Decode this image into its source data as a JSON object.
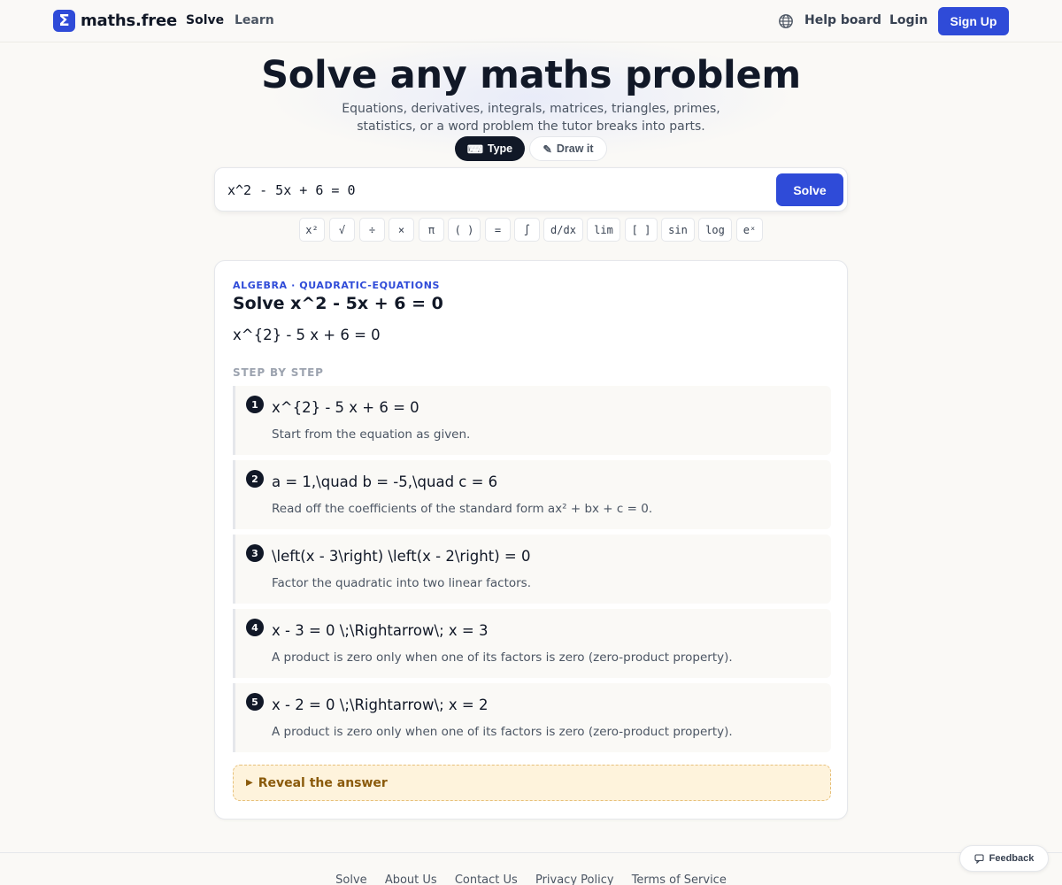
{
  "header": {
    "logo_glyph": "Σ",
    "logo_text": "maths.free",
    "nav": [
      "Solve",
      "Learn"
    ],
    "help_label": "Help board",
    "login_label": "Login",
    "signup_label": "Sign Up",
    "globe_icon": "globe-icon",
    "accent_color": "#2f4bd8"
  },
  "hero": {
    "title": "Solve any maths problem",
    "subtitle": "Equations, derivatives, integrals, matrices, triangles, primes, statistics, or a word problem the tutor breaks into parts.",
    "mode_type_label": "Type",
    "mode_type_icon": "⌨",
    "mode_draw_label": "Draw it",
    "mode_draw_icon": "✎"
  },
  "search": {
    "value": "x^2 - 5x + 6 = 0",
    "solve_label": "Solve"
  },
  "keys": [
    "x²",
    "√",
    "÷",
    "×",
    "π",
    "( )",
    "=",
    "∫",
    "d/dx",
    "lim",
    "[ ]",
    "sin",
    "log",
    "eˣ"
  ],
  "result": {
    "topic": "ALGEBRA · QUADRATIC-EQUATIONS",
    "title": "Solve x^2 - 5x + 6 = 0",
    "latex": "x^{2} - 5 x + 6 = 0",
    "steps_heading": "STEP BY STEP",
    "steps": [
      {
        "num": "1",
        "math": "x^{2} - 5 x + 6 = 0",
        "note": "Start from the equation as given."
      },
      {
        "num": "2",
        "math": "a = 1,\\quad b = -5,\\quad c = 6",
        "note": "Read off the coefficients of the standard form ax² + bx + c = 0."
      },
      {
        "num": "3",
        "math": "\\left(x - 3\\right) \\left(x - 2\\right) = 0",
        "note": "Factor the quadratic into two linear factors."
      },
      {
        "num": "4",
        "math": "x - 3 = 0 \\;\\Rightarrow\\; x = 3",
        "note": "A product is zero only when one of its factors is zero (zero-product property)."
      },
      {
        "num": "5",
        "math": "x - 2 = 0 \\;\\Rightarrow\\; x = 2",
        "note": "A product is zero only when one of its factors is zero (zero-product property)."
      }
    ],
    "reveal_label": "Reveal the answer",
    "reveal_icon": "▶"
  },
  "footer": {
    "links": [
      "Solve",
      "About Us",
      "Contact Us",
      "Privacy Policy",
      "Terms of Service"
    ],
    "feedback_label": "Feedback",
    "feedback_icon": "💬"
  }
}
